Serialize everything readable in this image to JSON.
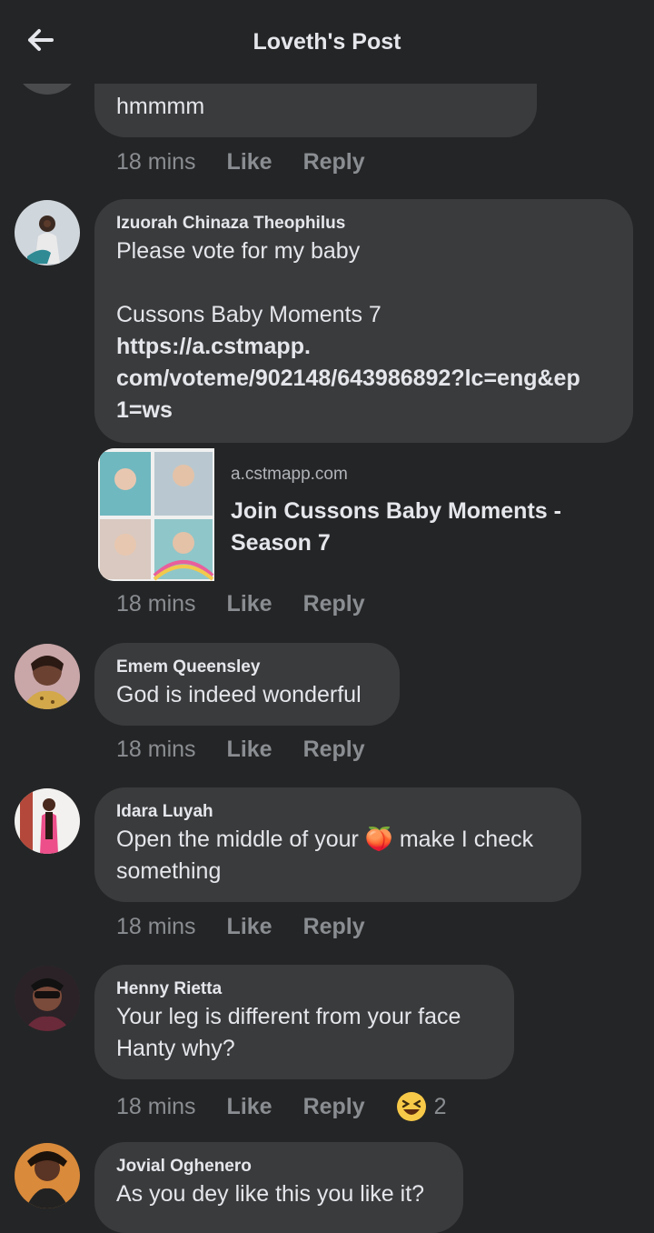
{
  "header": {
    "title": "Loveth's Post"
  },
  "comments": [
    {
      "name": "",
      "text": "hmmmm",
      "time": "18 mins",
      "like": "Like",
      "reply": "Reply"
    },
    {
      "name": "Izuorah Chinaza Theophilus",
      "text": "Please vote for my baby\n\nCussons Baby Moments 7",
      "link": "https://a.cstmapp.com/voteme/902148/643986892?lc=eng&ep1=ws",
      "link_display": "https://a.cstmapp.\ncom/voteme/902148/643986892?lc=eng&ep\n1=ws",
      "preview": {
        "domain": "a.cstmapp.com",
        "title": "Join Cussons Baby Moments - Season 7"
      },
      "time": "18 mins",
      "like": "Like",
      "reply": "Reply"
    },
    {
      "name": "Emem Queensley",
      "text": "God is indeed wonderful",
      "time": "18 mins",
      "like": "Like",
      "reply": "Reply"
    },
    {
      "name": "Idara Luyah",
      "text": "Open the middle of your 🍑 make I check something",
      "time": "18 mins",
      "like": "Like",
      "reply": "Reply"
    },
    {
      "name": "Henny Rietta",
      "text": "Your leg is different from your face Hanty why?",
      "time": "18 mins",
      "like": "Like",
      "reply": "Reply",
      "reactions": {
        "icon": "laughing-emoji-icon",
        "count": "2"
      }
    },
    {
      "name": "Jovial Oghenero",
      "text": "As you dey like this you like it?"
    }
  ],
  "colors": {
    "background": "#242526",
    "bubble": "#3a3b3c",
    "text": "#e4e6eb",
    "muted": "#8a8d91"
  }
}
